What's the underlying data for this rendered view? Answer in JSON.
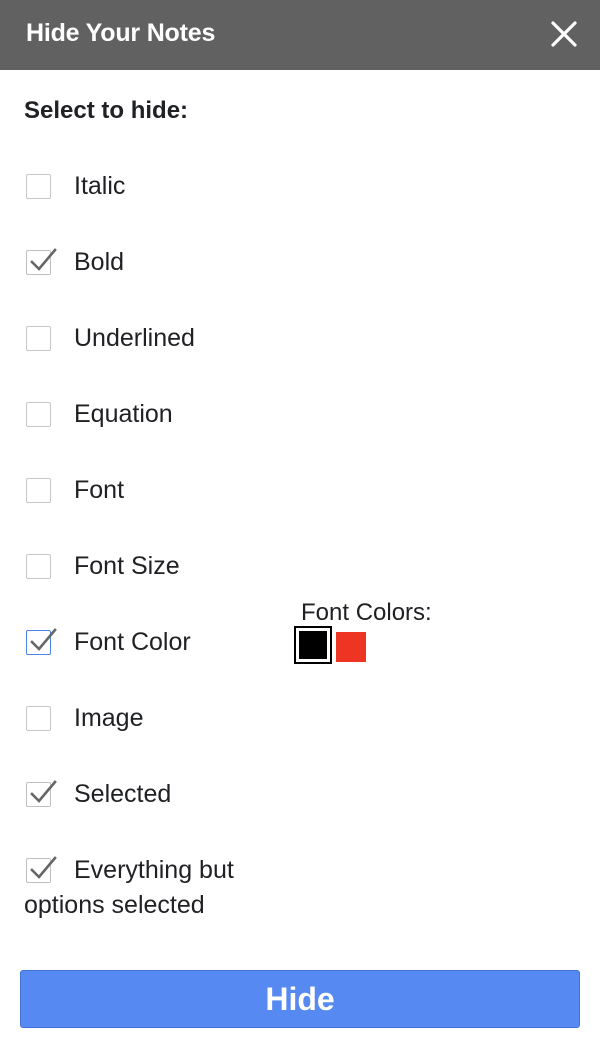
{
  "dialog": {
    "title": "Hide Your Notes",
    "close_icon": "close-icon"
  },
  "heading": "Select to hide:",
  "options": [
    {
      "label": "Italic",
      "checked": false
    },
    {
      "label": "Bold",
      "checked": true
    },
    {
      "label": "Underlined",
      "checked": false
    },
    {
      "label": "Equation",
      "checked": false
    },
    {
      "label": "Font",
      "checked": false
    },
    {
      "label": "Font Size",
      "checked": false
    },
    {
      "label": "Font Color",
      "checked": true,
      "focused": true
    },
    {
      "label": "Image",
      "checked": false
    },
    {
      "label": "Selected",
      "checked": true
    },
    {
      "label": "Everything but",
      "label_continued": "options selected",
      "checked": true
    }
  ],
  "font_colors": {
    "label": "Font Colors:",
    "swatches": [
      {
        "name": "black",
        "color": "#000000",
        "selected": true
      },
      {
        "name": "red",
        "color": "#ee3423",
        "selected": false
      }
    ]
  },
  "hide_button": {
    "label": "Hide",
    "color": "#568af2"
  },
  "colors": {
    "titlebar": "#616161",
    "checkmark": "#666666"
  }
}
